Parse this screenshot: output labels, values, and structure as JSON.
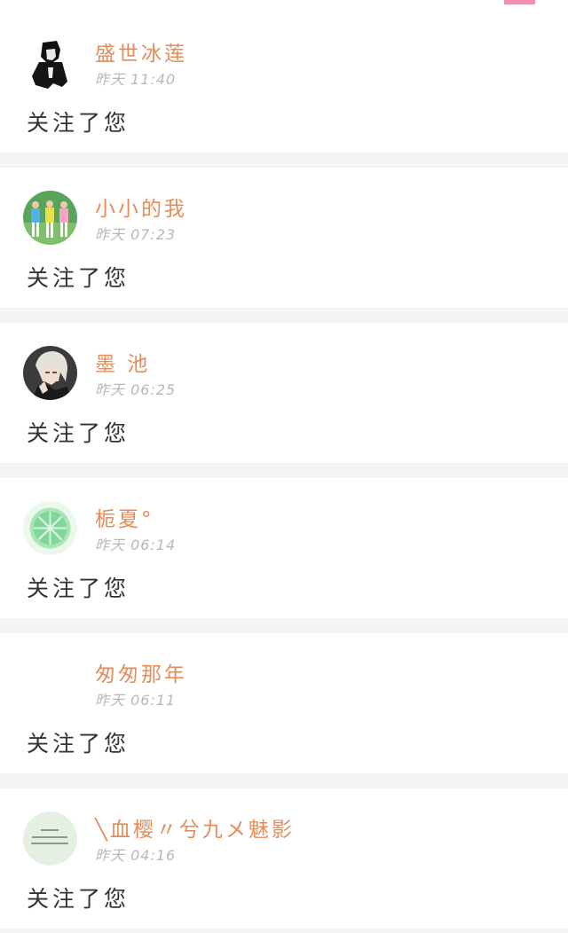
{
  "theme": {
    "accent": "#ef8fb1",
    "name_color": "#e38d5a",
    "time_color": "#b8b8b8",
    "text_color": "#333333",
    "background": "#f5f3f3"
  },
  "notifications": [
    {
      "name": "盛世冰莲",
      "time": "昨天 11:40",
      "message": "关注了您",
      "avatar": "dark-figure-avatar"
    },
    {
      "name": "小小的我",
      "time": "昨天 07:23",
      "message": "关注了您",
      "avatar": "group-photo-avatar"
    },
    {
      "name": "墨 池",
      "time": "昨天 06:25",
      "message": "关注了您",
      "avatar": "anime-boy-avatar"
    },
    {
      "name": "栀夏°",
      "time": "昨天 06:14",
      "message": "关注了您",
      "avatar": "lime-slice-avatar"
    },
    {
      "name": "匆匆那年",
      "time": "昨天 06:11",
      "message": "关注了您",
      "avatar": "blank-avatar"
    },
    {
      "name": "╲血樱〃兮九メ魅影",
      "time": "昨天 04:16",
      "message": "关注了您",
      "avatar": "text-note-avatar"
    }
  ]
}
